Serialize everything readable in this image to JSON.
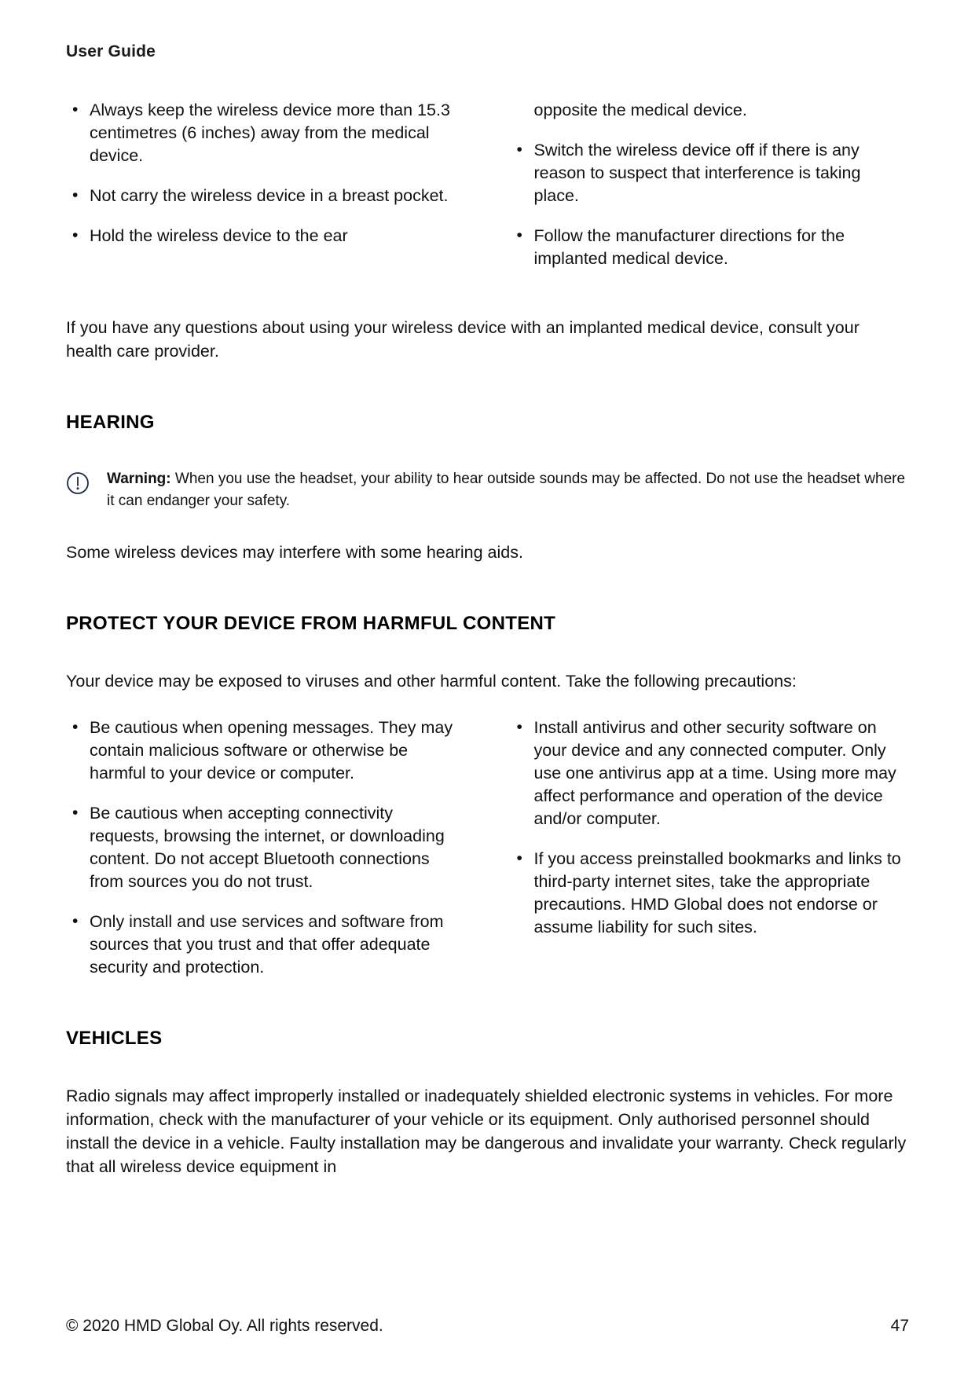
{
  "header": {
    "running_title": "User Guide"
  },
  "implanted_device_bullets": {
    "left": [
      "Always keep the wireless device more than 15.3 centimetres (6 inches) away from the medical device.",
      "Not carry the wireless device in a breast pocket.",
      "Hold the wireless device to the ear"
    ],
    "right_continuation": "opposite the medical device.",
    "right": [
      "Switch the wireless device off if there is any reason to suspect that interference is taking place.",
      "Follow the manufacturer directions for the implanted medical device."
    ]
  },
  "implanted_device_para": "If you have any questions about using your wireless device with an implanted medical device, consult your health care provider.",
  "hearing": {
    "title": "HEARING",
    "warning_icon": "warning-exclamation-circle-icon",
    "warning_label": "Warning:",
    "warning_text": "When you use the headset, your ability to hear outside sounds may be affected. Do not use the headset where it can endanger your safety.",
    "paragraph": "Some wireless devices may interfere with some hearing aids."
  },
  "harmful_content": {
    "title": "PROTECT YOUR DEVICE FROM HARMFUL CONTENT",
    "intro": "Your device may be exposed to viruses and other harmful content. Take the following precautions:",
    "left_bullets": [
      "Be cautious when opening messages. They may contain malicious software or otherwise be harmful to your device or computer.",
      "Be cautious when accepting connectivity requests, browsing the internet, or downloading content. Do not accept Bluetooth connections from sources you do not trust.",
      "Only install and use services and software from sources that you trust and that offer adequate security and protection."
    ],
    "right_bullets": [
      "Install antivirus and other security software on your device and any connected computer. Only use one antivirus app at a time. Using more may affect performance and operation of the device and/or computer.",
      "If you access preinstalled bookmarks and links to third-party internet sites, take the appropriate precautions. HMD Global does not endorse or assume liability for such sites."
    ]
  },
  "vehicles": {
    "title": "VEHICLES",
    "paragraph": "Radio signals may affect improperly installed or inadequately shielded electronic systems in vehicles. For more information, check with the manufacturer of your vehicle or its equipment. Only authorised personnel should install the device in a vehicle. Faulty installation may be dangerous and invalidate your warranty. Check regularly that all wireless device equipment in"
  },
  "footer": {
    "copyright": "© 2020 HMD Global Oy. All rights reserved.",
    "page_number": "47"
  },
  "colors": {
    "text": "#111111",
    "warning_icon": "#1b2a4a",
    "background": "#ffffff"
  }
}
